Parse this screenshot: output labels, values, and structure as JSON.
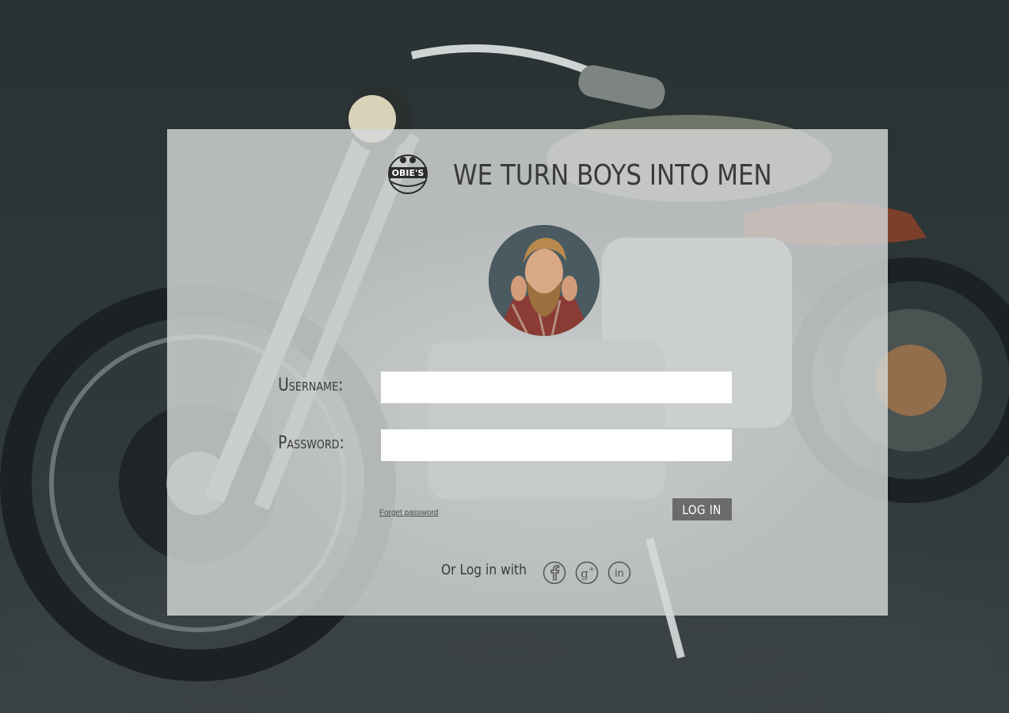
{
  "header": {
    "logo_text": "OBIE'S",
    "tagline": "WE TURN BOYS INTO MEN"
  },
  "form": {
    "username_label": "Username:",
    "username_value": "",
    "password_label": "Password:",
    "password_value": "",
    "forgot_link": "Forget password",
    "login_button": "LOG IN"
  },
  "social": {
    "prompt": "Or Log in with",
    "icons": [
      "facebook-icon",
      "google-plus-icon",
      "linkedin-icon"
    ]
  },
  "colors": {
    "panel": "#d6d8d8",
    "button": "#6b6b6b",
    "text": "#3a3a3a"
  }
}
